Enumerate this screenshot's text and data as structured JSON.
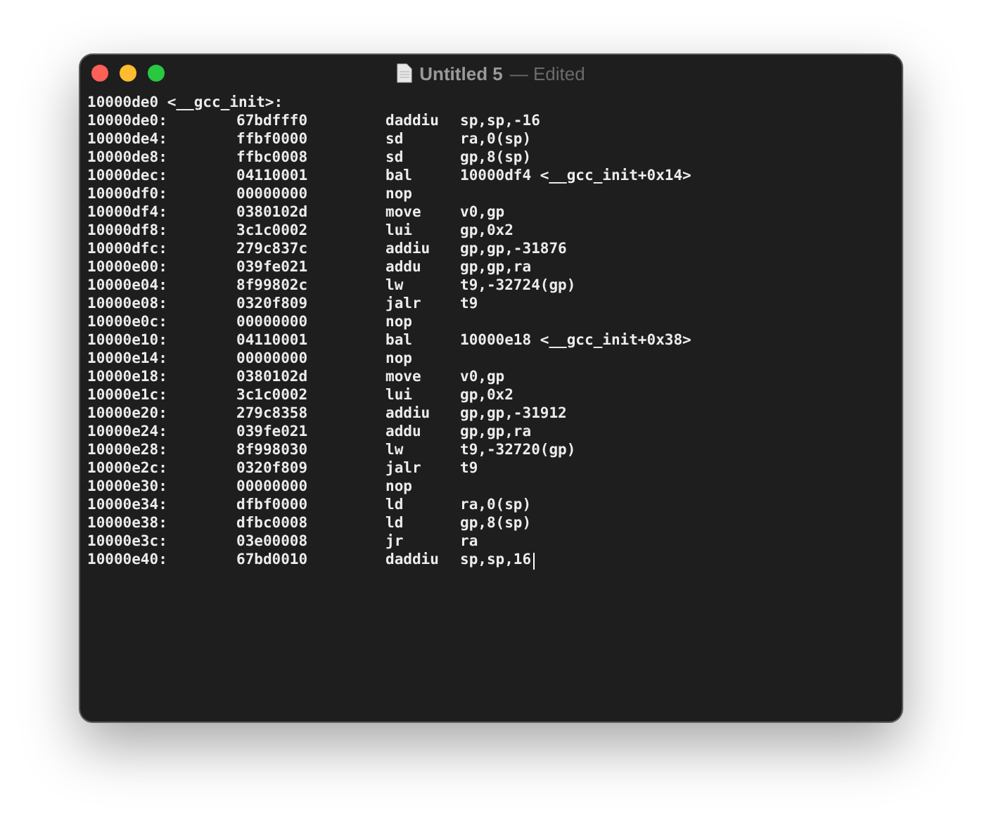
{
  "window": {
    "title": "Untitled 5",
    "subtitle": "— Edited"
  },
  "document": {
    "heading": "10000de0 <__gcc_init>:",
    "lines": [
      {
        "address": "10000de0:",
        "code": "67bdfff0",
        "mnemonic": "daddiu",
        "operands": "sp,sp,-16"
      },
      {
        "address": "10000de4:",
        "code": "ffbf0000",
        "mnemonic": "sd",
        "operands": "ra,0(sp)"
      },
      {
        "address": "10000de8:",
        "code": "ffbc0008",
        "mnemonic": "sd",
        "operands": "gp,8(sp)"
      },
      {
        "address": "10000dec:",
        "code": "04110001",
        "mnemonic": "bal",
        "operands": "10000df4 <__gcc_init+0x14>"
      },
      {
        "address": "10000df0:",
        "code": "00000000",
        "mnemonic": "nop"
      },
      {
        "address": "10000df4:",
        "code": "0380102d",
        "mnemonic": "move",
        "operands": "v0,gp"
      },
      {
        "address": "10000df8:",
        "code": "3c1c0002",
        "mnemonic": "lui",
        "operands": "gp,0x2"
      },
      {
        "address": "10000dfc:",
        "code": "279c837c",
        "mnemonic": "addiu",
        "operands": "gp,gp,-31876"
      },
      {
        "address": "10000e00:",
        "code": "039fe021",
        "mnemonic": "addu",
        "operands": "gp,gp,ra"
      },
      {
        "address": "10000e04:",
        "code": "8f99802c",
        "mnemonic": "lw",
        "operands": "t9,-32724(gp)"
      },
      {
        "address": "10000e08:",
        "code": "0320f809",
        "mnemonic": "jalr",
        "operands": "t9"
      },
      {
        "address": "10000e0c:",
        "code": "00000000",
        "mnemonic": "nop"
      },
      {
        "address": "10000e10:",
        "code": "04110001",
        "mnemonic": "bal",
        "operands": "10000e18 <__gcc_init+0x38>"
      },
      {
        "address": "10000e14:",
        "code": "00000000",
        "mnemonic": "nop"
      },
      {
        "address": "10000e18:",
        "code": "0380102d",
        "mnemonic": "move",
        "operands": "v0,gp"
      },
      {
        "address": "10000e1c:",
        "code": "3c1c0002",
        "mnemonic": "lui",
        "operands": "gp,0x2"
      },
      {
        "address": "10000e20:",
        "code": "279c8358",
        "mnemonic": "addiu",
        "operands": "gp,gp,-31912"
      },
      {
        "address": "10000e24:",
        "code": "039fe021",
        "mnemonic": "addu",
        "operands": "gp,gp,ra"
      },
      {
        "address": "10000e28:",
        "code": "8f998030",
        "mnemonic": "lw",
        "operands": "t9,-32720(gp)"
      },
      {
        "address": "10000e2c:",
        "code": "0320f809",
        "mnemonic": "jalr",
        "operands": "t9"
      },
      {
        "address": "10000e30:",
        "code": "00000000",
        "mnemonic": "nop"
      },
      {
        "address": "10000e34:",
        "code": "dfbf0000",
        "mnemonic": "ld",
        "operands": "ra,0(sp)"
      },
      {
        "address": "10000e38:",
        "code": "dfbc0008",
        "mnemonic": "ld",
        "operands": "gp,8(sp)"
      },
      {
        "address": "10000e3c:",
        "code": "03e00008",
        "mnemonic": "jr",
        "operands": "ra"
      },
      {
        "address": "10000e40:",
        "code": "67bd0010",
        "mnemonic": "daddiu",
        "operands": "sp,sp,16"
      }
    ]
  }
}
